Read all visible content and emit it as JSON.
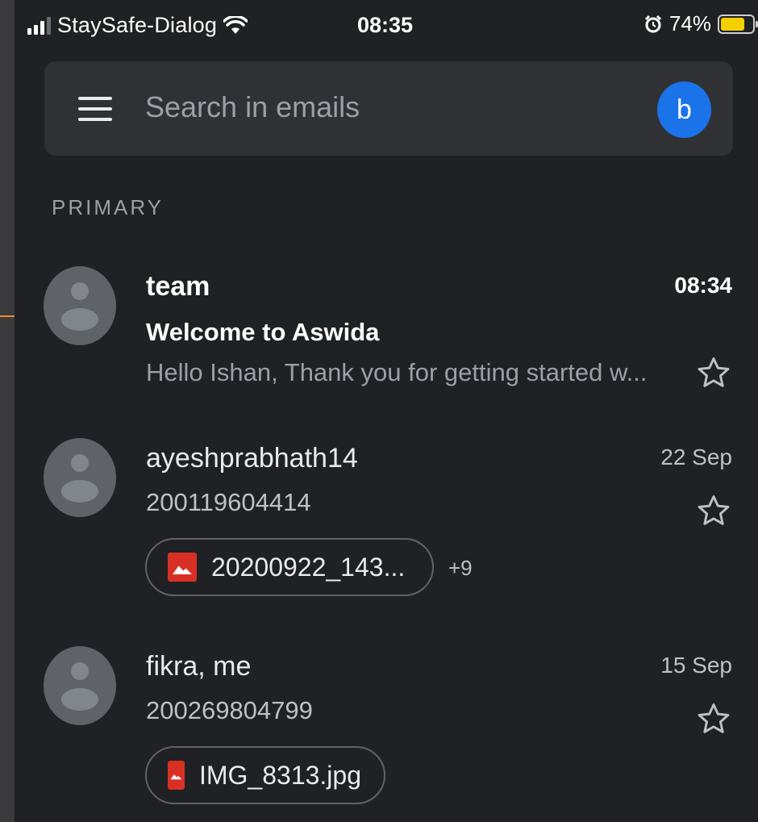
{
  "status_bar": {
    "carrier": "StaySafe-Dialog",
    "time": "08:35",
    "battery_percent": "74%",
    "battery_level": 0.74,
    "icons": [
      "signal-icon",
      "wifi-icon",
      "alarm-icon",
      "battery-icon"
    ]
  },
  "search": {
    "placeholder": "Search in emails",
    "account_initial": "b",
    "account_color": "#1a73e8"
  },
  "section_label": "PRIMARY",
  "emails": [
    {
      "sender": "team",
      "time": "08:34",
      "subject": "Welcome to Aswida",
      "snippet": "Hello Ishan, Thank you for getting started w...",
      "unread": true
    },
    {
      "sender": "ayeshprabhath14",
      "time": "22 Sep",
      "subject": "200119604414",
      "attachment": "20200922_143...",
      "more_attachments": "+9",
      "unread": false
    },
    {
      "sender": "fikra, me",
      "time": "15 Sep",
      "subject": "200269804799",
      "attachment": "IMG_8313.jpg",
      "unread": false
    }
  ],
  "colors": {
    "background": "#202124",
    "annotation_arrow": "#f28b22",
    "attachment_icon": "#d93025"
  }
}
